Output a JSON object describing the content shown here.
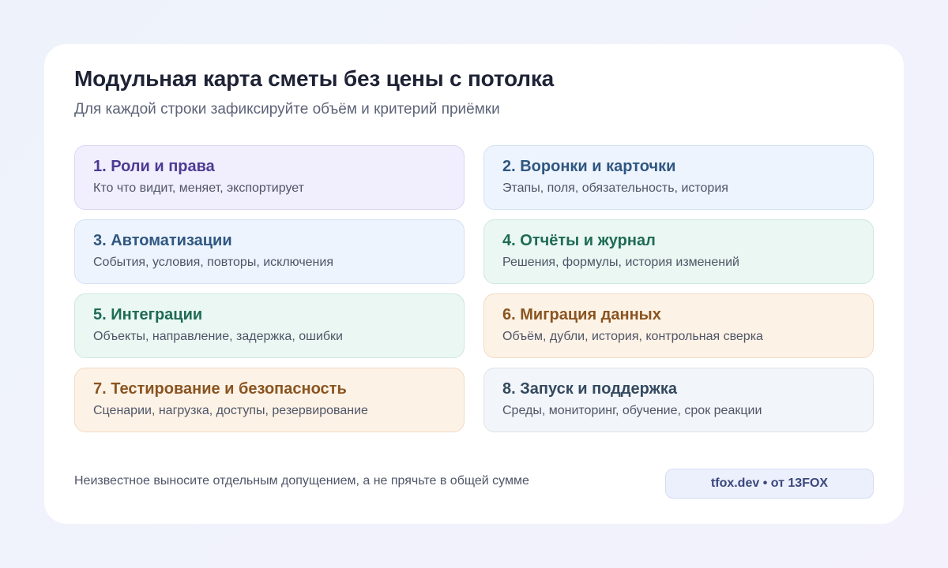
{
  "header": {
    "title": "Модульная карта сметы без цены с потолка",
    "subtitle": "Для каждой строки зафиксируйте объём и критерий приёмки"
  },
  "modules": [
    {
      "title": "1. Роли и права",
      "description": "Кто что видит, меняет, экспортирует",
      "color": "#4c3a92"
    },
    {
      "title": "2. Воронки и карточки",
      "description": "Этапы, поля, обязательность, история",
      "color": "#2f5780"
    },
    {
      "title": "3. Автоматизации",
      "description": "События, условия, повторы, исключения",
      "color": "#2f5780"
    },
    {
      "title": "4. Отчёты и журнал",
      "description": "Решения, формулы, история изменений",
      "color": "#1f6b55"
    },
    {
      "title": "5. Интеграции",
      "description": "Объекты, направление, задержка, ошибки",
      "color": "#1f6b55"
    },
    {
      "title": "6. Миграция данных",
      "description": "Объём, дубли, история, контрольная сверка",
      "color": "#8a5420"
    },
    {
      "title": "7. Тестирование и безопасность",
      "description": "Сценарии, нагрузка, доступы, резервирование",
      "color": "#8a5420"
    },
    {
      "title": "8. Запуск и поддержка",
      "description": "Среды, мониторинг, обучение, срок реакции",
      "color": "#34495f"
    }
  ],
  "footer": {
    "note": "Неизвестное выносите отдельным допущением, а не прячьте в общей сумме",
    "brand": "tfox.dev • от 13FOX"
  }
}
